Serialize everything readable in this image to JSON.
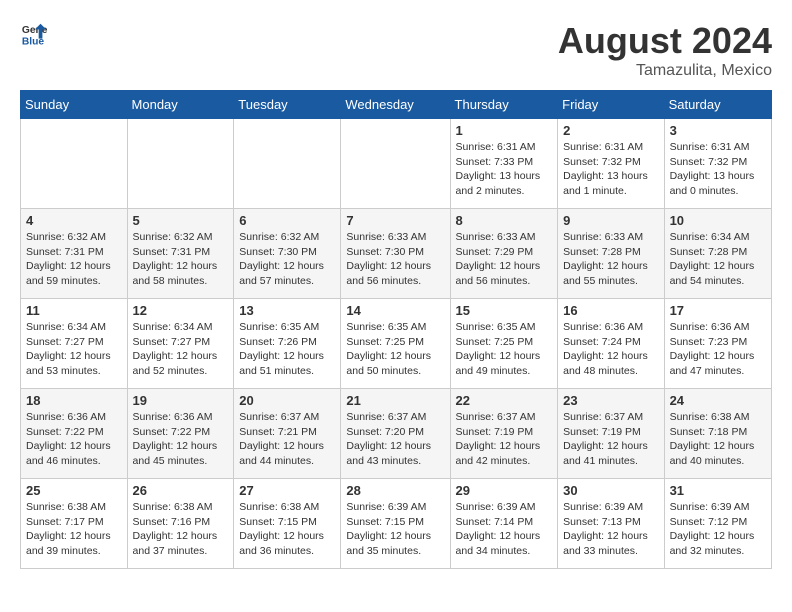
{
  "header": {
    "logo_line1": "General",
    "logo_line2": "Blue",
    "month_year": "August 2024",
    "location": "Tamazulita, Mexico"
  },
  "days_of_week": [
    "Sunday",
    "Monday",
    "Tuesday",
    "Wednesday",
    "Thursday",
    "Friday",
    "Saturday"
  ],
  "weeks": [
    [
      {
        "day": "",
        "detail": ""
      },
      {
        "day": "",
        "detail": ""
      },
      {
        "day": "",
        "detail": ""
      },
      {
        "day": "",
        "detail": ""
      },
      {
        "day": "1",
        "detail": "Sunrise: 6:31 AM\nSunset: 7:33 PM\nDaylight: 13 hours\nand 2 minutes."
      },
      {
        "day": "2",
        "detail": "Sunrise: 6:31 AM\nSunset: 7:32 PM\nDaylight: 13 hours\nand 1 minute."
      },
      {
        "day": "3",
        "detail": "Sunrise: 6:31 AM\nSunset: 7:32 PM\nDaylight: 13 hours\nand 0 minutes."
      }
    ],
    [
      {
        "day": "4",
        "detail": "Sunrise: 6:32 AM\nSunset: 7:31 PM\nDaylight: 12 hours\nand 59 minutes."
      },
      {
        "day": "5",
        "detail": "Sunrise: 6:32 AM\nSunset: 7:31 PM\nDaylight: 12 hours\nand 58 minutes."
      },
      {
        "day": "6",
        "detail": "Sunrise: 6:32 AM\nSunset: 7:30 PM\nDaylight: 12 hours\nand 57 minutes."
      },
      {
        "day": "7",
        "detail": "Sunrise: 6:33 AM\nSunset: 7:30 PM\nDaylight: 12 hours\nand 56 minutes."
      },
      {
        "day": "8",
        "detail": "Sunrise: 6:33 AM\nSunset: 7:29 PM\nDaylight: 12 hours\nand 56 minutes."
      },
      {
        "day": "9",
        "detail": "Sunrise: 6:33 AM\nSunset: 7:28 PM\nDaylight: 12 hours\nand 55 minutes."
      },
      {
        "day": "10",
        "detail": "Sunrise: 6:34 AM\nSunset: 7:28 PM\nDaylight: 12 hours\nand 54 minutes."
      }
    ],
    [
      {
        "day": "11",
        "detail": "Sunrise: 6:34 AM\nSunset: 7:27 PM\nDaylight: 12 hours\nand 53 minutes."
      },
      {
        "day": "12",
        "detail": "Sunrise: 6:34 AM\nSunset: 7:27 PM\nDaylight: 12 hours\nand 52 minutes."
      },
      {
        "day": "13",
        "detail": "Sunrise: 6:35 AM\nSunset: 7:26 PM\nDaylight: 12 hours\nand 51 minutes."
      },
      {
        "day": "14",
        "detail": "Sunrise: 6:35 AM\nSunset: 7:25 PM\nDaylight: 12 hours\nand 50 minutes."
      },
      {
        "day": "15",
        "detail": "Sunrise: 6:35 AM\nSunset: 7:25 PM\nDaylight: 12 hours\nand 49 minutes."
      },
      {
        "day": "16",
        "detail": "Sunrise: 6:36 AM\nSunset: 7:24 PM\nDaylight: 12 hours\nand 48 minutes."
      },
      {
        "day": "17",
        "detail": "Sunrise: 6:36 AM\nSunset: 7:23 PM\nDaylight: 12 hours\nand 47 minutes."
      }
    ],
    [
      {
        "day": "18",
        "detail": "Sunrise: 6:36 AM\nSunset: 7:22 PM\nDaylight: 12 hours\nand 46 minutes."
      },
      {
        "day": "19",
        "detail": "Sunrise: 6:36 AM\nSunset: 7:22 PM\nDaylight: 12 hours\nand 45 minutes."
      },
      {
        "day": "20",
        "detail": "Sunrise: 6:37 AM\nSunset: 7:21 PM\nDaylight: 12 hours\nand 44 minutes."
      },
      {
        "day": "21",
        "detail": "Sunrise: 6:37 AM\nSunset: 7:20 PM\nDaylight: 12 hours\nand 43 minutes."
      },
      {
        "day": "22",
        "detail": "Sunrise: 6:37 AM\nSunset: 7:19 PM\nDaylight: 12 hours\nand 42 minutes."
      },
      {
        "day": "23",
        "detail": "Sunrise: 6:37 AM\nSunset: 7:19 PM\nDaylight: 12 hours\nand 41 minutes."
      },
      {
        "day": "24",
        "detail": "Sunrise: 6:38 AM\nSunset: 7:18 PM\nDaylight: 12 hours\nand 40 minutes."
      }
    ],
    [
      {
        "day": "25",
        "detail": "Sunrise: 6:38 AM\nSunset: 7:17 PM\nDaylight: 12 hours\nand 39 minutes."
      },
      {
        "day": "26",
        "detail": "Sunrise: 6:38 AM\nSunset: 7:16 PM\nDaylight: 12 hours\nand 37 minutes."
      },
      {
        "day": "27",
        "detail": "Sunrise: 6:38 AM\nSunset: 7:15 PM\nDaylight: 12 hours\nand 36 minutes."
      },
      {
        "day": "28",
        "detail": "Sunrise: 6:39 AM\nSunset: 7:15 PM\nDaylight: 12 hours\nand 35 minutes."
      },
      {
        "day": "29",
        "detail": "Sunrise: 6:39 AM\nSunset: 7:14 PM\nDaylight: 12 hours\nand 34 minutes."
      },
      {
        "day": "30",
        "detail": "Sunrise: 6:39 AM\nSunset: 7:13 PM\nDaylight: 12 hours\nand 33 minutes."
      },
      {
        "day": "31",
        "detail": "Sunrise: 6:39 AM\nSunset: 7:12 PM\nDaylight: 12 hours\nand 32 minutes."
      }
    ]
  ]
}
